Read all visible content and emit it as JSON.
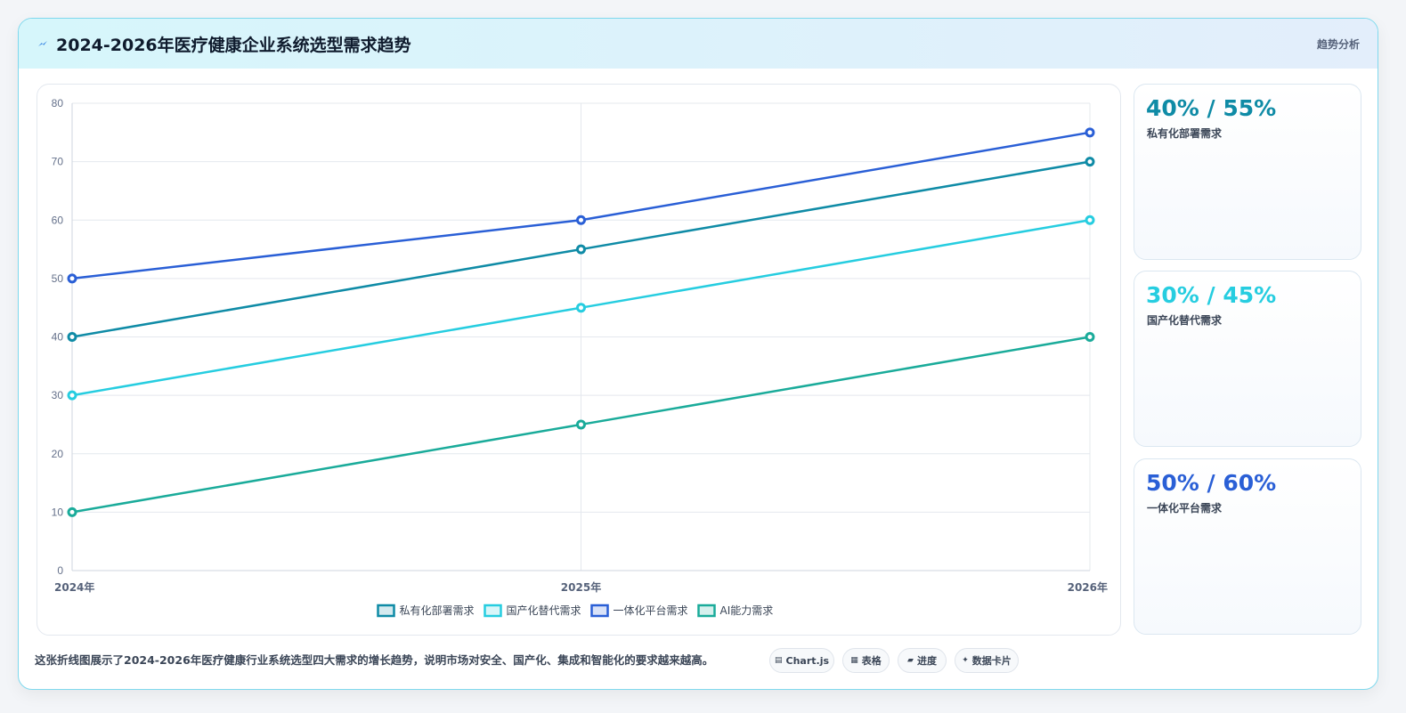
{
  "header": {
    "title": "2024-2026年医疗健康企业系统选型需求趋势",
    "right_label": "趋势分析",
    "icon": "lightning-icon",
    "icon_color": "#2a7de1"
  },
  "chart_data": {
    "type": "line",
    "categories": [
      "2024年",
      "2025年",
      "2026年"
    ],
    "ylim": [
      0,
      80
    ],
    "yticks": [
      0,
      10,
      20,
      30,
      40,
      50,
      60,
      70,
      80
    ],
    "grid": true,
    "legend_position": "bottom",
    "series": [
      {
        "name": "私有化部署需求",
        "values": [
          40,
          55,
          70
        ],
        "color": "#0f8ba6"
      },
      {
        "name": "国产化替代需求",
        "values": [
          30,
          45,
          60
        ],
        "color": "#26cde0"
      },
      {
        "name": "一体化平台需求",
        "values": [
          50,
          60,
          75
        ],
        "color": "#2a5fd6"
      },
      {
        "name": "AI能力需求",
        "values": [
          10,
          25,
          40
        ],
        "color": "#1aab9a"
      }
    ]
  },
  "side_cards": [
    {
      "value": "40% / 55%",
      "label": "私有化部署需求",
      "color": "#0f8ba6"
    },
    {
      "value": "30% / 45%",
      "label": "国产化替代需求",
      "color": "#26cde0"
    },
    {
      "value": "50% / 60%",
      "label": "一体化平台需求",
      "color": "#2a5fd6"
    }
  ],
  "footer": {
    "description": "这张折线图展示了2024-2026年医疗健康行业系统选型四大需求的增长趋势，说明市场对安全、国产化、集成和智能化的要求越来越高。",
    "tags": [
      {
        "label": "Chart.js",
        "icon": "chart-icon"
      },
      {
        "label": "表格",
        "icon": "table-icon"
      },
      {
        "label": "进度",
        "icon": "progress-icon"
      },
      {
        "label": "数据卡片",
        "icon": "card-icon"
      }
    ]
  }
}
